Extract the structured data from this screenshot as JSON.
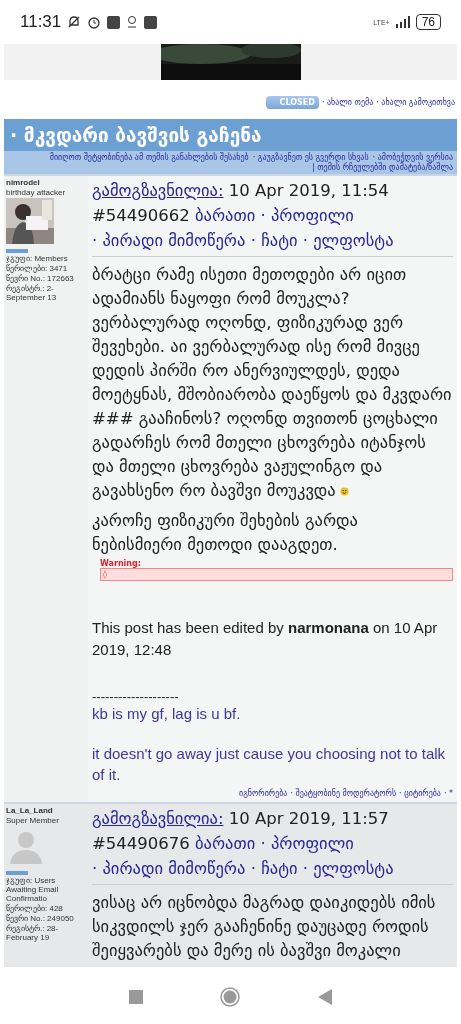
{
  "status_bar": {
    "time": "11:31",
    "network": "LTE+",
    "battery": "76"
  },
  "thread_actions": {
    "badge": "CLOSED",
    "links": [
      "· ახალი თემა",
      "· ახალი გამოკითხვა"
    ]
  },
  "topic": {
    "title": "· მკვდარი ბავშვის გაჩენა",
    "options": [
      "მიიღოთ შეტყობინება ამ თემის განახლების შესახებ",
      "· გაუგზავნეთ ეს გვერდი სხვას",
      "· ამობეჭდვის ვერსია",
      "| თემის რჩეულებში დამატება/წაშლა"
    ]
  },
  "posts": [
    {
      "author": {
        "name": "nimrodel",
        "title": "birthday attacker",
        "group": "ჯგუფი: Members",
        "posts": "წერილები: 3471",
        "member_no": "წევრი No.: 172663",
        "joined": "რეგისტრ.: 2-September 13"
      },
      "posted_label": "გამოგზავნილია:",
      "date": "10 Apr 2019, 11:54",
      "number": "#54490662",
      "links": [
        "ბარათი",
        "· პროფილი",
        "· პირადი მიმოწერა",
        "· ჩატი",
        "· ელფოსტა"
      ],
      "shaded": false,
      "body": [
        {
          "text": "ბრატცი რამე ისეთი მეთოდები არ იცით ადამიანს ნაყოფი რომ მოუკლა? ვერბალურად ოღონდ, ფიზიკურად ვერ შევეხები. აი ვერბალურად ისე რომ მივცე დედის პირში რო ანერვიულდეს, დედა მოეტყნას, მშობიარობა დაეწყოს და მკვდარი ### გააჩინოს? ოღონდ თვითონ ცოცხალი გადარჩეს რომ მთელი ცხოვრება იტანჯოს და მთელი ცხოვრება ვაჟულინგო და გავახსენო რო ბავშვი მოუკვდა",
          "smiley": true
        },
        {
          "text": "კაროჩე ფიზიკური შეხების გარდა ნებისმიერი მეთოდი დააგდეთ.",
          "smiley": false
        }
      ],
      "warning": {
        "label": "Warning:",
        "value": "◊"
      },
      "edit_note": "This post has been edited by **narmonana** on 10 Apr 2019, 12:48",
      "signature": {
        "rule": "--------------------",
        "lines": [
          "kb is my gf, lag is u bf.",
          "it doesn't go away just cause you choosing not to talk of it."
        ]
      },
      "footer_links": [
        "იგნორირება",
        "· შეატყობინე მოდერატორს",
        "· ციტირება",
        "· *"
      ]
    },
    {
      "author": {
        "name": "La_La_Land",
        "title": "Super Member",
        "avatar": {
          "kind": "icon"
        },
        "group": "ჯგუფი: Users Awaiting Email Confirmatio",
        "posts": "წერილები: 428",
        "member_no": "წევრი No.: 249050",
        "joined": "რეგისტრ.: 28-February 19"
      },
      "posted_label": "გამოგზავნილია:",
      "date": "10 Apr 2019, 11:57",
      "number": "#54490676",
      "links": [
        "ბარათი",
        "· პროფილი",
        "· პირადი მიმოწერა",
        "· ჩატი",
        "· ელფოსტა"
      ],
      "shaded": true,
      "body": [
        {
          "text": "ვისაც არ იცნობდა მაგრად დაიკიდებს იმის სიკვდილს ჯერ გააჩენინე დაუცადე როდის შეიყვარებს და მერე ის ბავშვი მოკალი",
          "smiley": false
        }
      ]
    }
  ]
}
